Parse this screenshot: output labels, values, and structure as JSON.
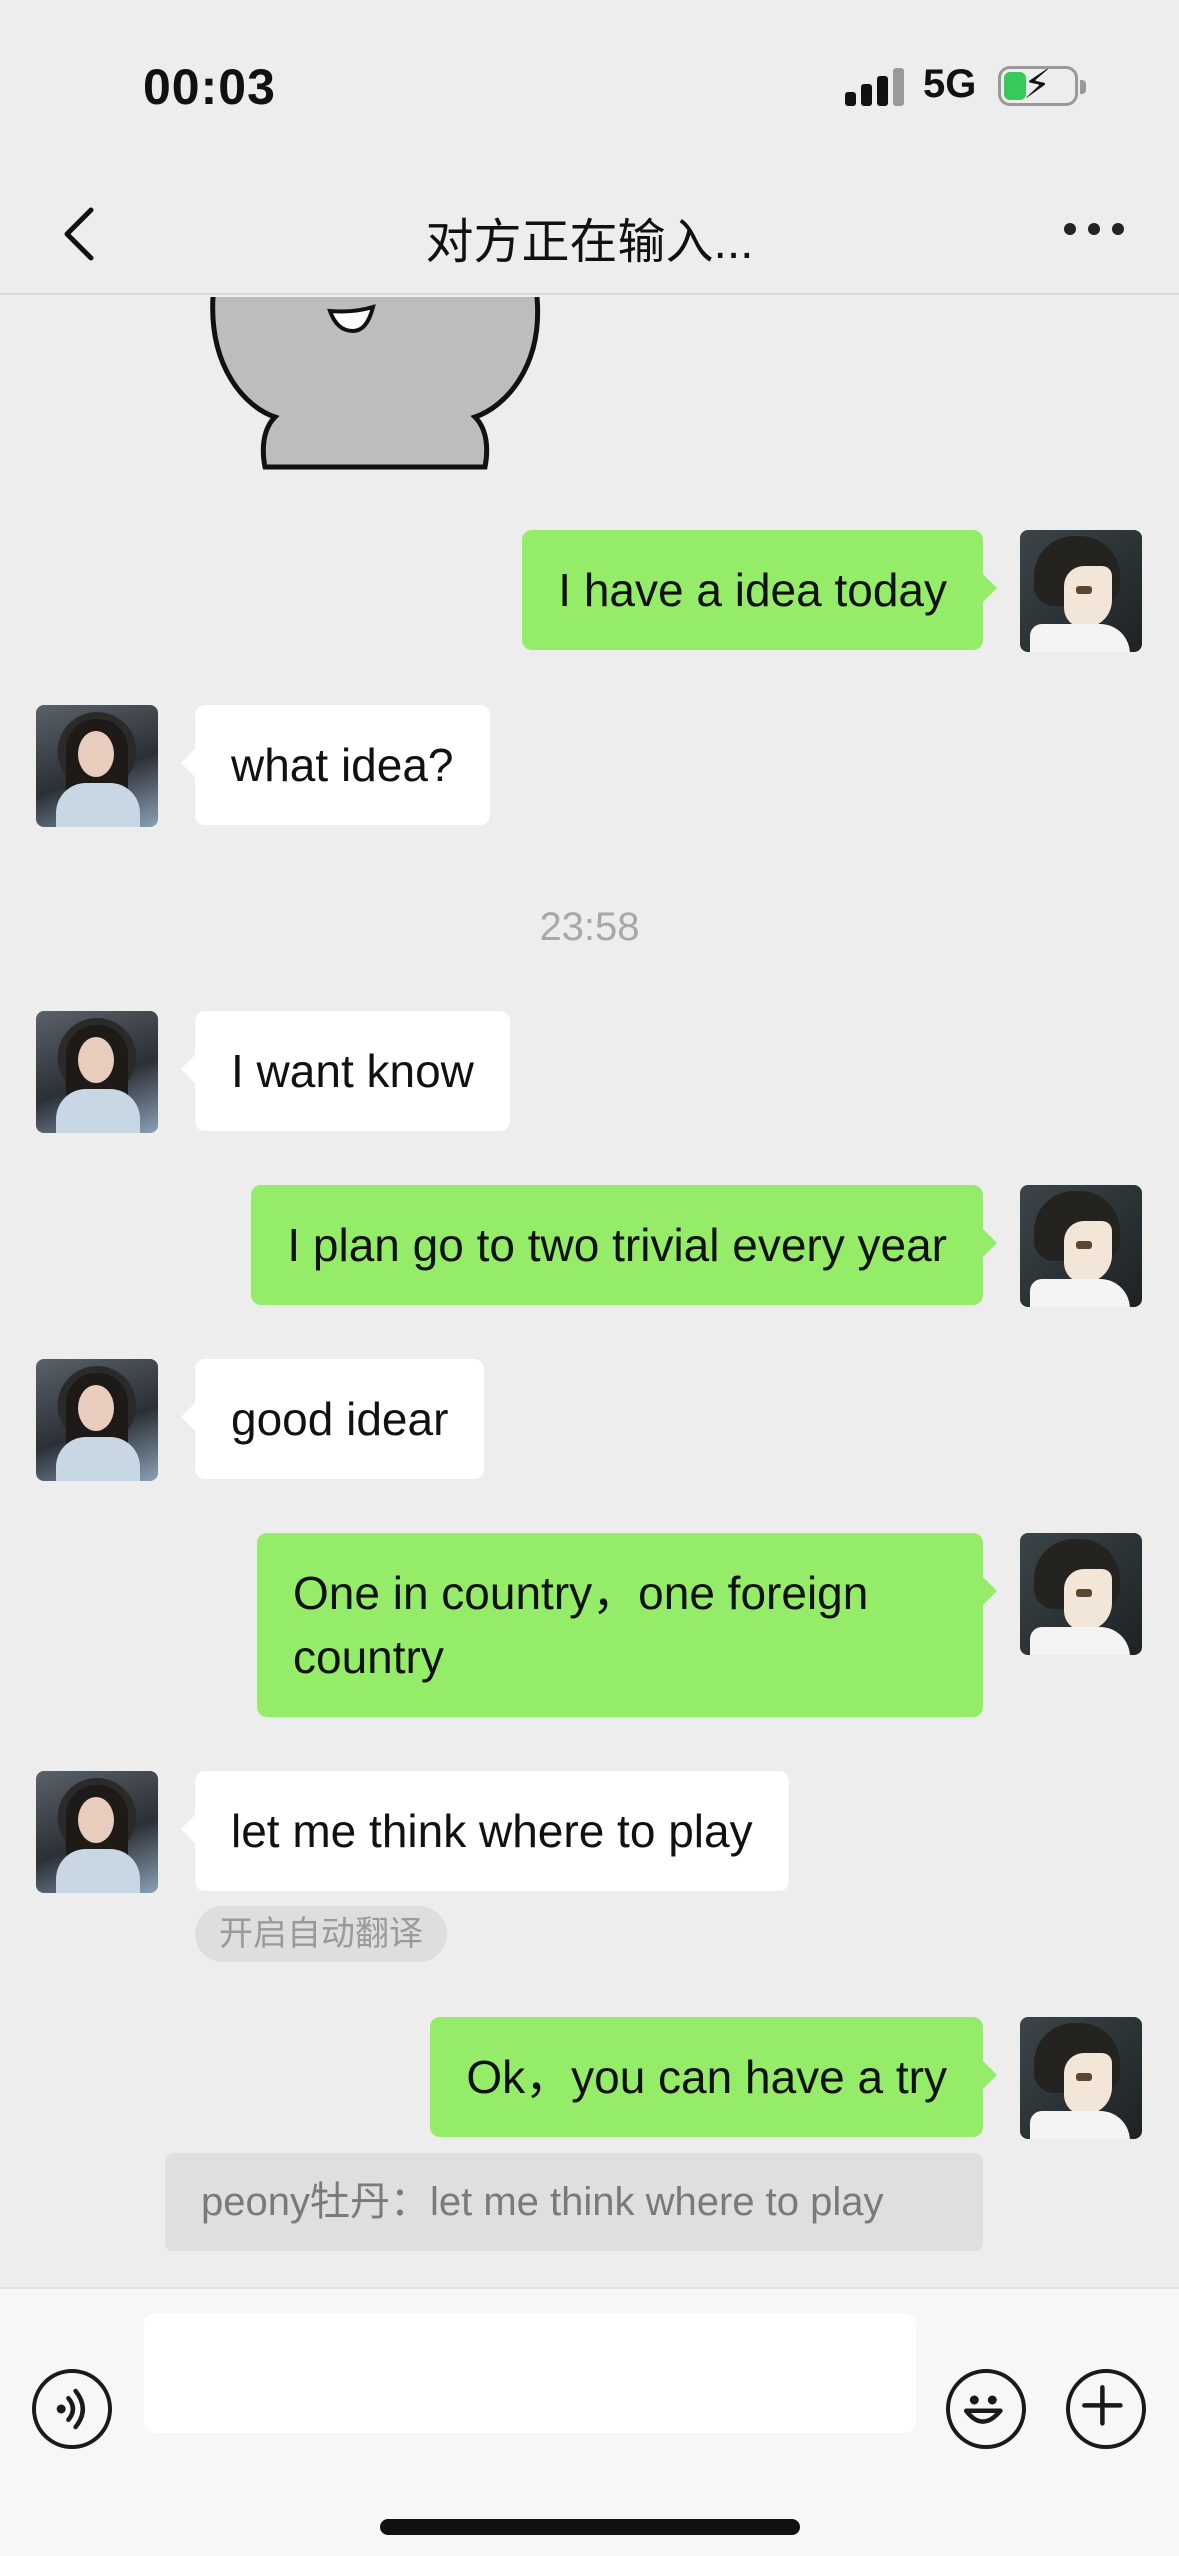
{
  "status_bar": {
    "time": "00:03",
    "network": "5G"
  },
  "nav": {
    "title": "对方正在输入..."
  },
  "messages": {
    "m1": "I have a idea today",
    "m2": "what idea?",
    "timestamp": "23:58",
    "m3": "I want know",
    "m4": "I plan go to two trivial every year",
    "m5": "good idear",
    "m6_line1": "One in country，one foreign",
    "m6_line2": "country",
    "m7": "let me think where to play",
    "translate_chip": "开启自动翻译",
    "m8": "Ok，you can have a try",
    "quote": "peony牡丹：let me think where to play"
  },
  "input": {
    "value": ""
  },
  "icons": {
    "back": "chevron-left-icon",
    "more": "more-dots-icon",
    "voice": "voice-icon",
    "emoji": "emoji-icon",
    "plus": "plus-icon"
  },
  "colors": {
    "outgoing_bubble": "#95ec69",
    "incoming_bubble": "#ffffff",
    "background": "#ededed"
  }
}
